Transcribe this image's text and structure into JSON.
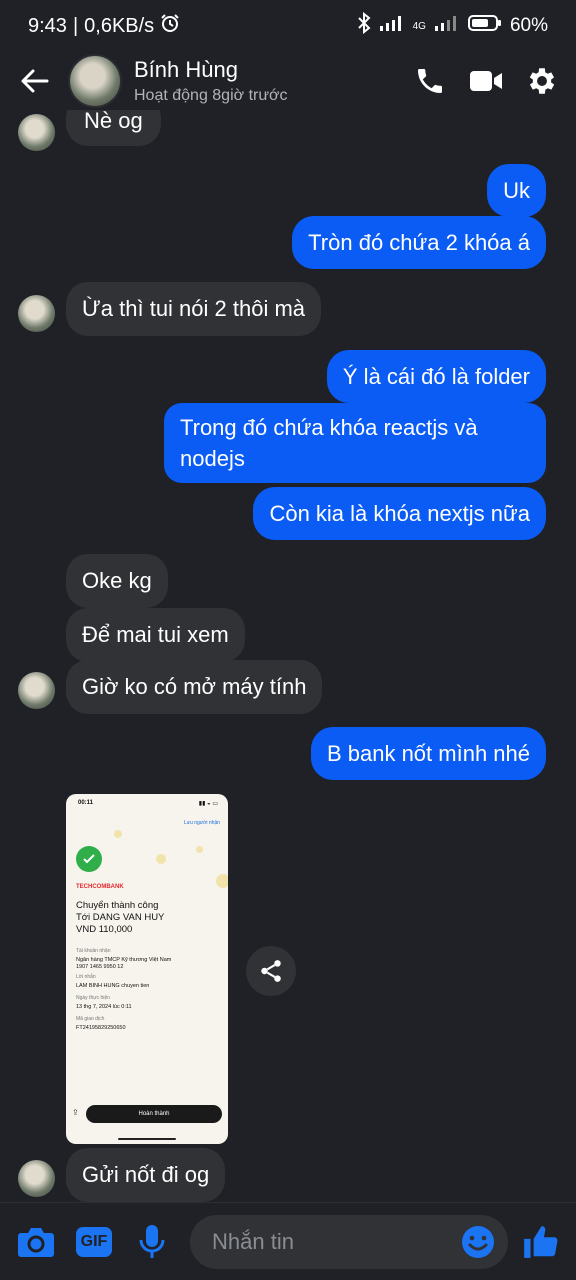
{
  "status_bar": {
    "time": "9:43",
    "net_speed": "0,6KB/s",
    "network": "4G",
    "battery": "60%"
  },
  "header": {
    "contact_name": "Bính Hùng",
    "contact_status": "Hoạt động 8giờ trước"
  },
  "messages": [
    {
      "dir": "in",
      "text": "Nè og"
    },
    {
      "dir": "out",
      "text": "Uk"
    },
    {
      "dir": "out",
      "text": "Tròn đó chứa 2 khóa á"
    },
    {
      "dir": "in",
      "text": "Ừa thì tui nói 2 thôi mà"
    },
    {
      "dir": "out",
      "text": "Ý là cái đó là folder"
    },
    {
      "dir": "out",
      "text": "Trong đó chứa khóa reactjs và nodejs"
    },
    {
      "dir": "out",
      "text": "Còn kia là khóa nextjs nữa"
    },
    {
      "dir": "in",
      "text": "Oke kg"
    },
    {
      "dir": "in",
      "text": "Để mai tui xem"
    },
    {
      "dir": "in",
      "text": "Giờ ko có mở máy tính"
    },
    {
      "dir": "out",
      "text": "B bank nốt mình nhé"
    },
    {
      "dir": "in",
      "text": "Gửi nốt đi og"
    }
  ],
  "receipt": {
    "time": "00:11",
    "save_recipient": "Lưu người nhận",
    "bank_logo": "TECHCOMBANK",
    "title_line1": "Chuyển thành công",
    "title_line2": "Tới DANG VAN HUY",
    "title_line3": "VND 110,000",
    "label_account": "Tài khoản nhận",
    "bank_name": "Ngân hàng TMCP Kỹ thương Việt Nam",
    "account_number": "1907 1465 9950 12",
    "label_message": "Lời nhắn",
    "message": "LAM BINH HUNG  chuyen tien",
    "label_date": "Ngày thực hiện",
    "date": "13 thg 7, 2024 lúc 0:11",
    "label_txn": "Mã giao dịch",
    "txn_id": "FT24195829250650",
    "done_button": "Hoàn thành"
  },
  "composer": {
    "placeholder": "Nhắn tin",
    "gif_label": "GIF"
  },
  "colors": {
    "background": "#1f2126",
    "outgoing_bubble": "#0a5cf5",
    "incoming_bubble": "#303236",
    "accent": "#1b74f2"
  }
}
